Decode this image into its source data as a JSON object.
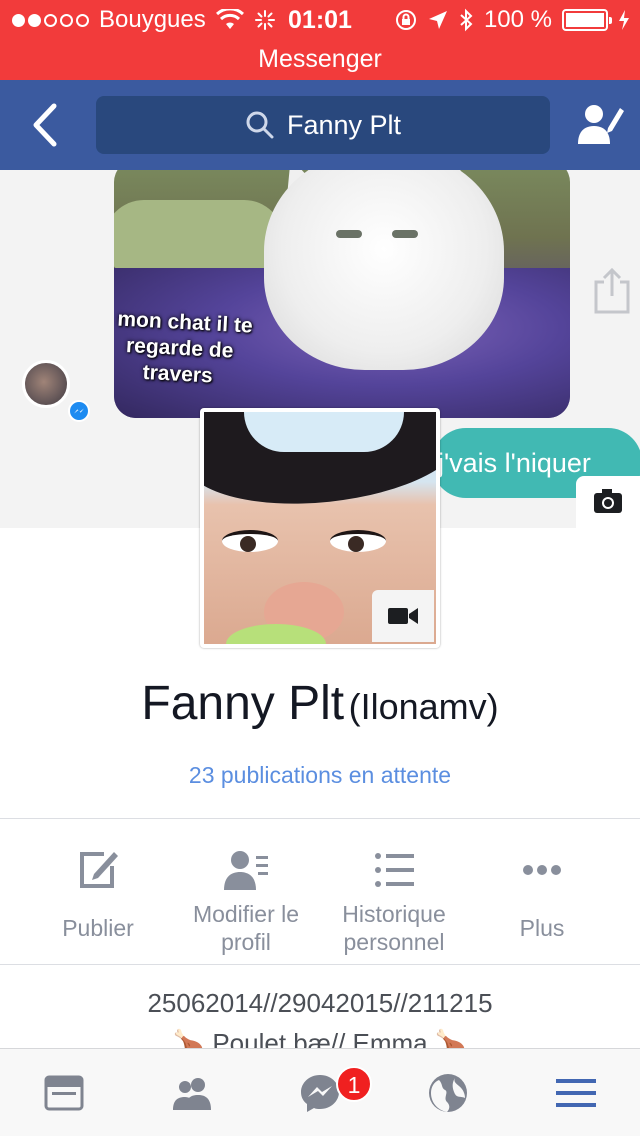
{
  "status_bar": {
    "carrier": "Bouygues",
    "time": "01:01",
    "battery": "100 %",
    "icons": [
      "signal-dots-icon",
      "wifi-icon",
      "activity-icon",
      "rotation-lock-icon",
      "location-icon",
      "bluetooth-icon",
      "battery-icon",
      "charging-icon"
    ]
  },
  "return_bar": {
    "label": "Messenger"
  },
  "nav": {
    "search_value": "Fanny Plt",
    "icons": [
      "back-icon",
      "search-icon",
      "edit-profile-icon"
    ]
  },
  "cover": {
    "photo_caption": [
      "mon chat il te",
      "regarde de",
      "travers"
    ],
    "bubble_text": "j'vais l'niquer",
    "icons": [
      "share-icon",
      "camera-icon",
      "messenger-icon"
    ]
  },
  "profile": {
    "name": "Fanny Plt",
    "alt_name": "(Ilonamv)",
    "pending_posts": "23 publications en attente",
    "video_icon": "video-camera-icon"
  },
  "actions": [
    {
      "label": "Publier",
      "icon": "compose-icon"
    },
    {
      "label": "Modifier le profil",
      "line1": "Modifier le",
      "line2": "profil",
      "icon": "edit-profile-icon"
    },
    {
      "label": "Historique personnel",
      "line1": "Historique",
      "line2": "personnel",
      "icon": "list-icon"
    },
    {
      "label": "Plus",
      "icon": "more-icon"
    }
  ],
  "bio": {
    "line1": "25062014//29042015//211215",
    "line2": "🍗 Poulet bæ// Emma 🍗"
  },
  "tab_bar": {
    "tabs": [
      {
        "name": "news-feed",
        "icon": "news-feed-icon"
      },
      {
        "name": "friends",
        "icon": "friends-icon"
      },
      {
        "name": "messenger",
        "icon": "messenger-icon",
        "badge": "1"
      },
      {
        "name": "notifications",
        "icon": "globe-icon"
      },
      {
        "name": "menu",
        "icon": "menu-icon",
        "active": true
      }
    ],
    "active_color": "#4267b2",
    "inactive_color": "#7f8490"
  },
  "colors": {
    "status_bar": "#f23b3b",
    "nav_bar": "#3b5a9f",
    "link": "#5b8ee0"
  }
}
